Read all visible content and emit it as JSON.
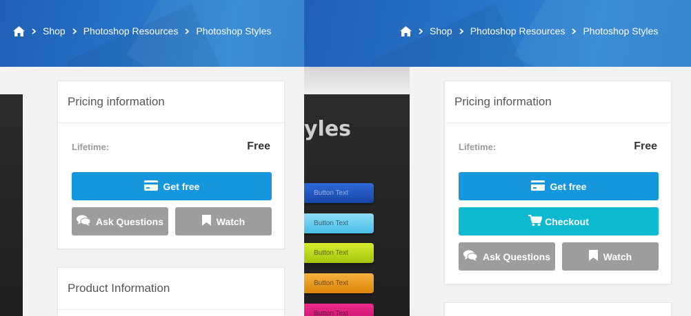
{
  "breadcrumb": {
    "home_icon": "home-icon",
    "items": [
      "Shop",
      "Photoshop Resources",
      "Photoshop Styles"
    ]
  },
  "preview": {
    "title_fragment": "yles",
    "button_text": "Button Text",
    "button_colors": [
      "#1f57c4",
      "#6ccff2",
      "#c2dc1b",
      "#ec9e22",
      "#dc1b7e"
    ]
  },
  "pricing": {
    "title": "Pricing information",
    "lifetime_label": "Lifetime:",
    "price": "Free",
    "get_free_label": "Get free",
    "checkout_label": "Checkout",
    "ask_label": "Ask Questions",
    "watch_label": "Watch"
  },
  "product": {
    "title": "Product Information"
  },
  "colors": {
    "header_blue": "#2a77c9",
    "get_free": "#1696dd",
    "checkout": "#0dbad0",
    "gray_button": "#9d9d9d"
  }
}
